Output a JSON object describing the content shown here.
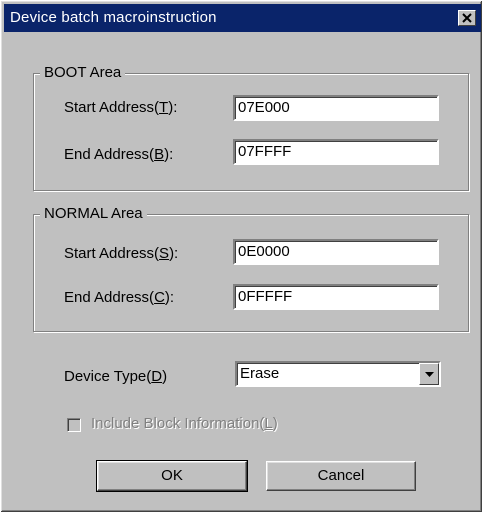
{
  "window": {
    "title": "Device batch macroinstruction"
  },
  "boot_area": {
    "legend": "BOOT Area",
    "start_label": "Start Address(",
    "start_key": "T",
    "start_value": "07E000",
    "end_label": "End Address(",
    "end_key": "B",
    "end_value": "07FFFF"
  },
  "normal_area": {
    "legend": "NORMAL Area",
    "start_label": "Start Address(",
    "start_key": "S",
    "start_value": "0E0000",
    "end_label": "End Address(",
    "end_key": "C",
    "end_value": "0FFFFF"
  },
  "device_type": {
    "label": "Device Type(",
    "key": "D",
    "value": "Erase"
  },
  "include_block": {
    "label": "Include Block Information(",
    "key": "L",
    "checked": false,
    "enabled": false
  },
  "buttons": {
    "ok": "OK",
    "cancel": "Cancel"
  },
  "label_suffix": "):",
  "label_suffix_plain": ")"
}
